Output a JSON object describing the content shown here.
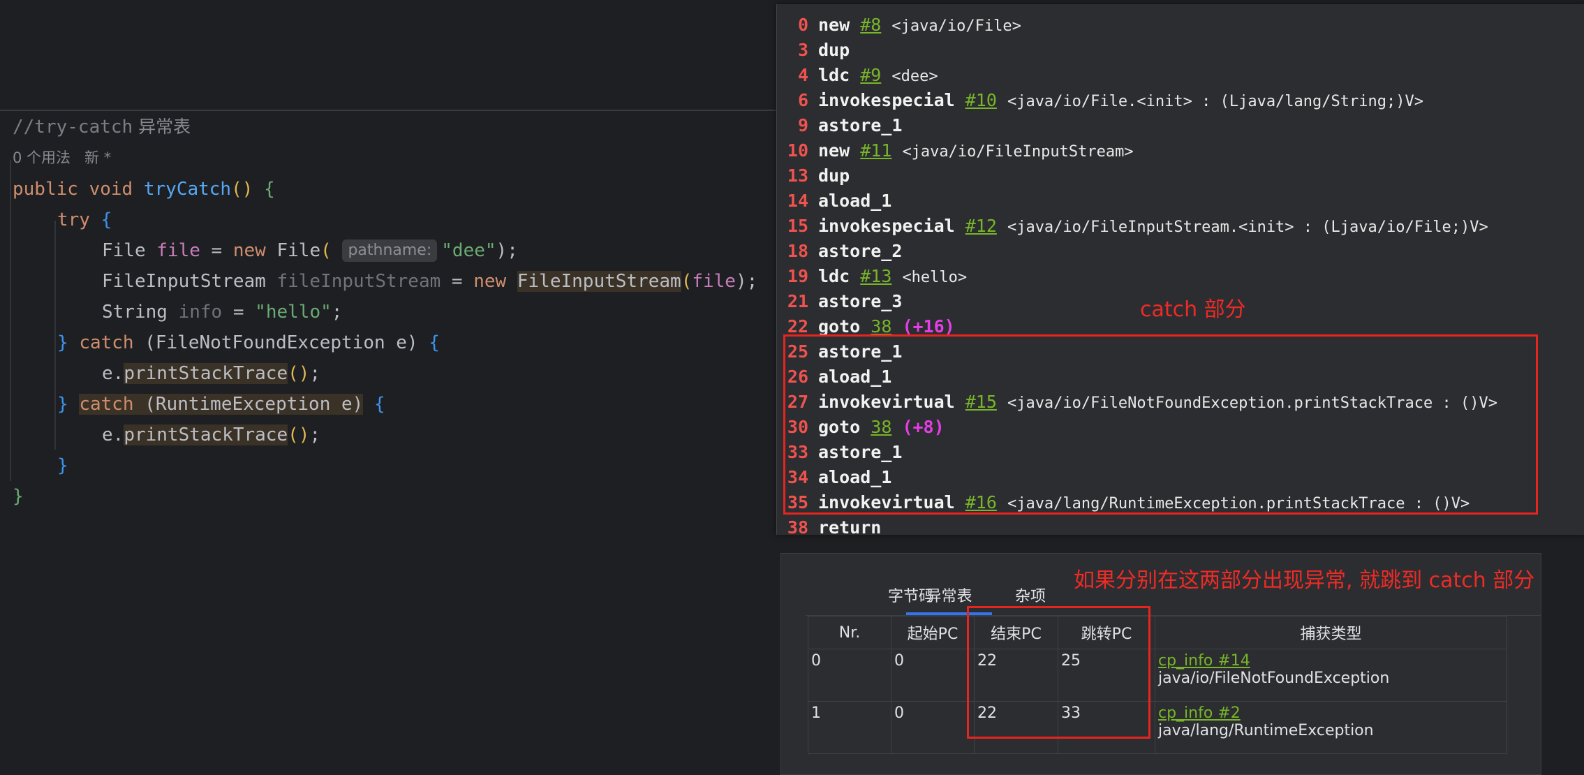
{
  "editor": {
    "comment": "//try-catch",
    "comment_cn": " 异常表",
    "usage_hint": "0 个用法   新 *",
    "lines": {
      "sig_kw1": "public",
      "sig_kw2": "void",
      "sig_name": "tryCatch",
      "sig_parens": "()",
      "sig_brace": "{",
      "try_kw": "try",
      "try_brace": "{",
      "l1_type": "File",
      "l1_var": "file",
      "l1_eq": " = ",
      "l1_new": "new",
      "l1_ctor": "File",
      "l1_open": "(",
      "l1_hint": "pathname:",
      "l1_str": "\"dee\"",
      "l1_close": ");",
      "l2_type": "FileInputStream",
      "l2_var": "fileInputStream",
      "l2_eq": " = ",
      "l2_new": "new",
      "l2_ctor": "FileInputStream",
      "l2_open": "(",
      "l2_arg": "file",
      "l2_close": ");",
      "l3_type": "String",
      "l3_var": "info",
      "l3_eq": " = ",
      "l3_str": "\"hello\"",
      "l3_semi": ";",
      "c1_brace": "}",
      "c1_kw": "catch",
      "c1_params": "(FileNotFoundException e)",
      "c1_obrace": "{",
      "p1_recv": "e.",
      "p1_call": "printStackTrace",
      "p1_parens": "()",
      "p1_semi": ";",
      "c2_brace": "}",
      "c2_kw": "catch",
      "c2_params": "(RuntimeException e)",
      "c2_obrace": "{",
      "p2_recv": "e.",
      "p2_call": "printStackTrace",
      "p2_parens": "()",
      "p2_semi": ";",
      "end_try": "}",
      "end_method": "}"
    }
  },
  "bytecode": [
    {
      "n": "0",
      "op": "new",
      "ref": "#8",
      "arg": "<java/io/File>"
    },
    {
      "n": "3",
      "op": "dup"
    },
    {
      "n": "4",
      "op": "ldc",
      "ref": "#9",
      "arg": "<dee>"
    },
    {
      "n": "6",
      "op": "invokespecial",
      "ref": "#10",
      "arg": "<java/io/File.<init> : (Ljava/lang/String;)V>"
    },
    {
      "n": "9",
      "op": "astore_1"
    },
    {
      "n": "10",
      "op": "new",
      "ref": "#11",
      "arg": "<java/io/FileInputStream>"
    },
    {
      "n": "13",
      "op": "dup"
    },
    {
      "n": "14",
      "op": "aload_1"
    },
    {
      "n": "15",
      "op": "invokespecial",
      "ref": "#12",
      "arg": "<java/io/FileInputStream.<init> : (Ljava/io/File;)V>"
    },
    {
      "n": "18",
      "op": "astore_2"
    },
    {
      "n": "19",
      "op": "ldc",
      "ref": "#13",
      "arg": "<hello>"
    },
    {
      "n": "21",
      "op": "astore_3"
    },
    {
      "n": "22",
      "op": "goto",
      "ref": "38",
      "off": "(+16)"
    },
    {
      "n": "25",
      "op": "astore_1"
    },
    {
      "n": "26",
      "op": "aload_1"
    },
    {
      "n": "27",
      "op": "invokevirtual",
      "ref": "#15",
      "arg": "<java/io/FileNotFoundException.printStackTrace : ()V>"
    },
    {
      "n": "30",
      "op": "goto",
      "ref": "38",
      "off": "(+8)"
    },
    {
      "n": "33",
      "op": "astore_1"
    },
    {
      "n": "34",
      "op": "aload_1"
    },
    {
      "n": "35",
      "op": "invokevirtual",
      "ref": "#16",
      "arg": "<java/lang/RuntimeException.printStackTrace : ()V>"
    },
    {
      "n": "38",
      "op": "return"
    }
  ],
  "tabs": [
    "字节码",
    "异常表",
    "杂项"
  ],
  "exception_table": {
    "headers": [
      "Nr.",
      "起始PC",
      "结束PC",
      "跳转PC",
      "捕获类型"
    ],
    "rows": [
      {
        "nr": "0",
        "start": "0",
        "end": "22",
        "handler": "25",
        "type_ref": "cp_info #14",
        "type_name": "java/io/FileNotFoundException"
      },
      {
        "nr": "1",
        "start": "0",
        "end": "22",
        "handler": "33",
        "type_ref": "cp_info #2",
        "type_name": "java/lang/RuntimeException"
      }
    ]
  },
  "annotations": {
    "catch_label": "catch 部分",
    "explain_label": "如果分别在这两部分出现异常, 就跳到 catch 部分"
  },
  "colors": {
    "background": "#1e1f22",
    "panel": "#2b2d30",
    "annotation_red": "#e8241f",
    "ref_green": "#79b52a",
    "offset_magenta": "#e53ee6",
    "tab_accent": "#3574f0"
  }
}
